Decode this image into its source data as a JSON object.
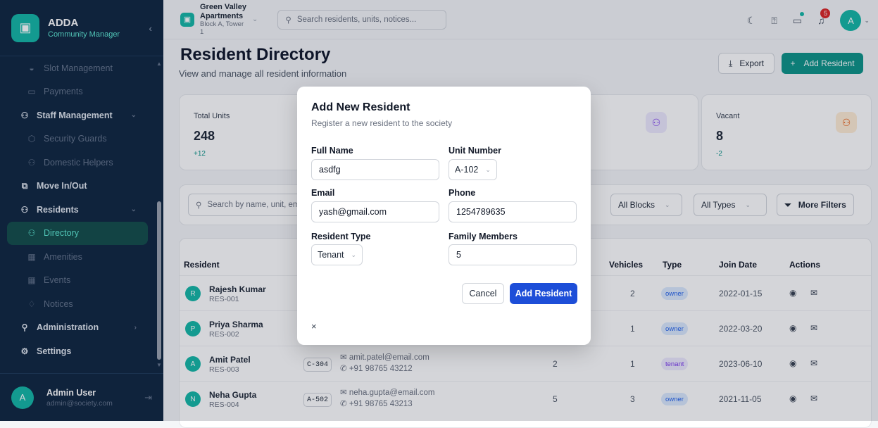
{
  "brand": {
    "name": "ADDA",
    "subtitle": "Community Manager",
    "logo_icon": "building-icon",
    "collapse_icon": "chevron-left-icon"
  },
  "sidebar": {
    "items": [
      {
        "label": "Slot Management",
        "icon": "◒",
        "kind": "sub"
      },
      {
        "label": "Payments",
        "icon": "▭",
        "kind": "sub"
      },
      {
        "label": "Staff Management",
        "icon": "⚇",
        "kind": "group",
        "chevron": "⌄"
      },
      {
        "label": "Security Guards",
        "icon": "⬡",
        "kind": "sub"
      },
      {
        "label": "Domestic Helpers",
        "icon": "⚇",
        "kind": "sub"
      },
      {
        "label": "Move In/Out",
        "icon": "⧉",
        "kind": "group"
      },
      {
        "label": "Residents",
        "icon": "⚇",
        "kind": "group",
        "chevron": "⌄"
      },
      {
        "label": "Directory",
        "icon": "⚇",
        "kind": "active"
      },
      {
        "label": "Amenities",
        "icon": "▦",
        "kind": "sub"
      },
      {
        "label": "Events",
        "icon": "▦",
        "kind": "sub"
      },
      {
        "label": "Notices",
        "icon": "♢",
        "kind": "sub"
      },
      {
        "label": "Administration",
        "icon": "⚲",
        "kind": "group",
        "chevron": "›"
      },
      {
        "label": "Settings",
        "icon": "⚙",
        "kind": "group"
      }
    ]
  },
  "user": {
    "initial": "A",
    "name": "Admin User",
    "email": "admin@society.com"
  },
  "topbar": {
    "property_name": "Green Valley Apartments",
    "property_location": "Block A, Tower 1",
    "search_placeholder": "Search residents, units, notices...",
    "notification_count": "5",
    "avatar_initial": "A"
  },
  "page": {
    "title": "Resident Directory",
    "subtitle": "View and manage all resident information",
    "export_label": "Export",
    "add_label": "Add Resident"
  },
  "stats": [
    {
      "label": "Total Units",
      "value": "248",
      "delta": "+12"
    },
    {
      "label": "Vacant",
      "value": "8",
      "delta": "-2"
    }
  ],
  "filters": {
    "search_placeholder": "Search by name, unit, email...",
    "blocks": "All Blocks",
    "types": "All Types",
    "more": "More Filters"
  },
  "table": {
    "headers": {
      "resident": "Resident",
      "vehicles": "Vehicles",
      "type": "Type",
      "join_date": "Join Date",
      "actions": "Actions"
    },
    "rows": [
      {
        "initial": "R",
        "name": "Rajesh Kumar",
        "id": "RES-001",
        "unit": "",
        "email": "",
        "phone": "",
        "family": "",
        "vehicles": "2",
        "type": "owner",
        "join": "2022-01-15"
      },
      {
        "initial": "P",
        "name": "Priya Sharma",
        "id": "RES-002",
        "unit": "",
        "email": "",
        "phone": "",
        "family": "",
        "vehicles": "1",
        "type": "owner",
        "join": "2022-03-20"
      },
      {
        "initial": "A",
        "name": "Amit Patel",
        "id": "RES-003",
        "unit": "C-304",
        "email": "amit.patel@email.com",
        "phone": "+91 98765 43212",
        "family": "2",
        "vehicles": "1",
        "type": "tenant",
        "join": "2023-06-10"
      },
      {
        "initial": "N",
        "name": "Neha Gupta",
        "id": "RES-004",
        "unit": "A-502",
        "email": "neha.gupta@email.com",
        "phone": "+91 98765 43213",
        "family": "5",
        "vehicles": "3",
        "type": "owner",
        "join": "2021-11-05"
      }
    ]
  },
  "modal": {
    "title": "Add New Resident",
    "subtitle": "Register a new resident to the society",
    "full_name_label": "Full Name",
    "full_name_value": "asdfg",
    "unit_label": "Unit Number",
    "unit_value": "A-102",
    "email_label": "Email",
    "email_value": "yash@gmail.com",
    "phone_label": "Phone",
    "phone_value": "1254789635",
    "type_label": "Resident Type",
    "type_value": "Tenant",
    "family_label": "Family Members",
    "family_value": "5",
    "cancel_label": "Cancel",
    "submit_label": "Add Resident",
    "close_glyph": "×"
  }
}
